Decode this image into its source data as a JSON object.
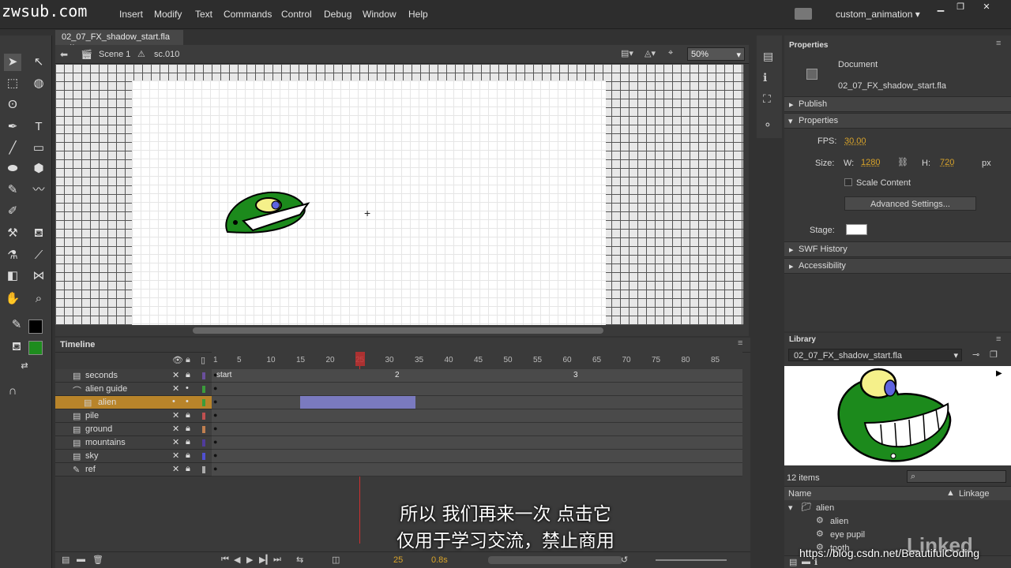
{
  "watermark_logo": "zwsub.com",
  "menu": [
    "Insert",
    "Modify",
    "Text",
    "Commands",
    "Control",
    "Debug",
    "Window",
    "Help"
  ],
  "workspace": "custom_animation",
  "tab": {
    "title": "02_07_FX_shadow_start.fla",
    "close": "×"
  },
  "editbar": {
    "scene": "Scene 1",
    "symbol": "sc.010",
    "zoom": "50%"
  },
  "timeline": {
    "title": "Timeline",
    "ruler": [
      "1",
      "5",
      "10",
      "15",
      "20",
      "25",
      "30",
      "35",
      "40",
      "45",
      "50",
      "55",
      "60",
      "65",
      "70",
      "75",
      "80",
      "85"
    ],
    "layers": [
      {
        "name": "seconds",
        "color": "#6a4f9c"
      },
      {
        "name": "alien guide",
        "color": "#3b9c3b"
      },
      {
        "name": "alien",
        "color": "#3b9c3b",
        "selected": true
      },
      {
        "name": "pile",
        "color": "#c05050"
      },
      {
        "name": "ground",
        "color": "#c07f50"
      },
      {
        "name": "mountains",
        "color": "#503b9c"
      },
      {
        "name": "sky",
        "color": "#5050d0"
      },
      {
        "name": "ref",
        "color": "#aaaaaa"
      }
    ],
    "frame_labels": [
      "start",
      "2",
      "3"
    ],
    "status": {
      "fps": "25",
      "time": "0.8s"
    }
  },
  "properties": {
    "title": "Properties",
    "doc_type": "Document",
    "doc_name": "02_07_FX_shadow_start.fla",
    "publish": "Publish",
    "section": "Properties",
    "fps_label": "FPS:",
    "fps": "30.00",
    "size_label": "Size:",
    "w_label": "W:",
    "w": "1280",
    "h_label": "H:",
    "h": "720",
    "unit": "px",
    "scale_content": "Scale Content",
    "advanced": "Advanced Settings...",
    "stage_label": "Stage:",
    "swf_history": "SWF History",
    "accessibility": "Accessibility"
  },
  "library": {
    "title": "Library",
    "doc": "02_07_FX_shadow_start.fla",
    "count": "12 items",
    "col_name": "Name",
    "col_linkage": "Linkage",
    "items": [
      "alien",
      "alien",
      "eye pupil",
      "tooth"
    ]
  },
  "subtitles": {
    "line1": "所以  我们再来一次  点击它",
    "line2": "仅用于学习交流，禁止商用"
  },
  "watermark_url": "https://blog.csdn.net/BeautifulCoding",
  "linkedin": "Linked"
}
